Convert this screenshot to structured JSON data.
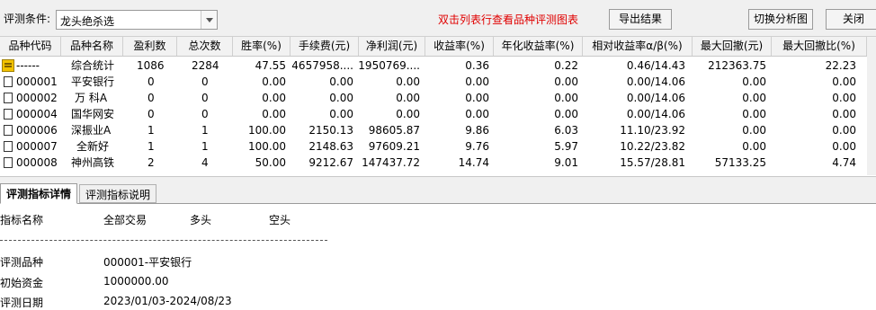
{
  "toolbar": {
    "condition_label": "评测条件:",
    "condition_value": "龙头绝杀选",
    "hint": "双击列表行查看品种评测图表",
    "export_label": "导出结果",
    "switch_label": "切换分析图",
    "close_label": "关闭"
  },
  "table": {
    "headers": [
      "品种代码",
      "品种名称",
      "盈利数",
      "总次数",
      "胜率(%)",
      "手续费(元)",
      "净利润(元)",
      "收益率(%)",
      "年化收益率(%)",
      "相对收益率α/β(%)",
      "最大回撤(元)",
      "最大回撤比(%)"
    ],
    "rows": [
      [
        "------",
        "综合统计",
        "1086",
        "2284",
        "47.55",
        "4657958....",
        "1950769....",
        "0.36",
        "0.22",
        "0.46/14.43",
        "212363.75",
        "22.23"
      ],
      [
        "000001",
        "平安银行",
        "0",
        "0",
        "0.00",
        "0.00",
        "0.00",
        "0.00",
        "0.00",
        "0.00/14.06",
        "0.00",
        "0.00"
      ],
      [
        "000002",
        "万 科A",
        "0",
        "0",
        "0.00",
        "0.00",
        "0.00",
        "0.00",
        "0.00",
        "0.00/14.06",
        "0.00",
        "0.00"
      ],
      [
        "000004",
        "国华网安",
        "0",
        "0",
        "0.00",
        "0.00",
        "0.00",
        "0.00",
        "0.00",
        "0.00/14.06",
        "0.00",
        "0.00"
      ],
      [
        "000006",
        "深振业A",
        "1",
        "1",
        "100.00",
        "2150.13",
        "98605.87",
        "9.86",
        "6.03",
        "11.10/23.92",
        "0.00",
        "0.00"
      ],
      [
        "000007",
        "全新好",
        "1",
        "1",
        "100.00",
        "2148.63",
        "97609.21",
        "9.76",
        "5.97",
        "10.22/23.82",
        "0.00",
        "0.00"
      ],
      [
        "000008",
        "神州高铁",
        "2",
        "4",
        "50.00",
        "9212.67",
        "147437.72",
        "14.74",
        "9.01",
        "15.57/28.81",
        "57133.25",
        "4.74"
      ]
    ]
  },
  "tabs": [
    {
      "label": "评测指标详情"
    },
    {
      "label": "评测指标说明"
    }
  ],
  "detail": {
    "columns": [
      "指标名称",
      "全部交易",
      "多头",
      "空头"
    ],
    "items": [
      {
        "name": "评测品种",
        "value": "000001-平安银行"
      },
      {
        "name": "初始资金",
        "value": "1000000.00"
      },
      {
        "name": "评测日期",
        "value": "2023/01/03-2024/08/23"
      }
    ]
  }
}
